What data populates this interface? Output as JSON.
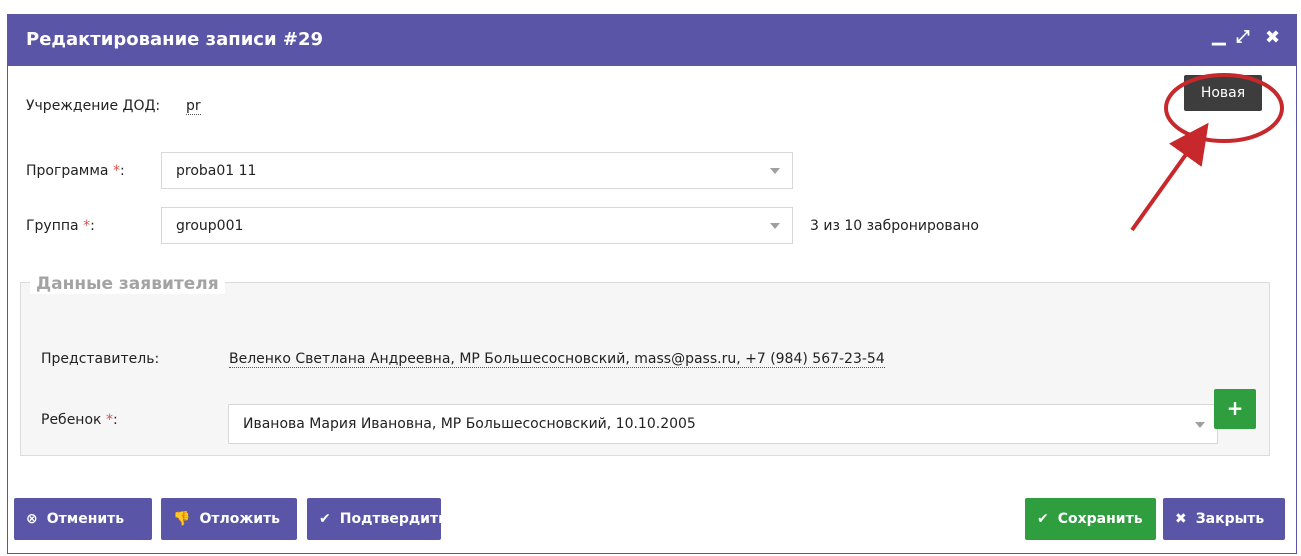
{
  "window": {
    "title": "Редактирование записи #29",
    "controls": {
      "minimize": "▁",
      "maximize": "⤢",
      "close": "✖"
    }
  },
  "form": {
    "institution": {
      "label": "Учреждение ДОД:",
      "value": "pr"
    },
    "status_badge": "Новая",
    "program": {
      "label": "Программа",
      "required_mark": "*",
      "colon": ":",
      "value": "proba01 11"
    },
    "group": {
      "label": "Группа",
      "required_mark": "*",
      "colon": ":",
      "value": "group001",
      "booking_note": "3 из 10 забронировано"
    }
  },
  "applicant": {
    "legend": "Данные заявителя",
    "representative": {
      "label": "Представитель:",
      "value": "Веленко Светлана Андреевна, МР Большесосновский, mass@pass.ru, +7 (984) 567-23-54"
    },
    "child": {
      "label": "Ребенок",
      "required_mark": "*",
      "colon": ":",
      "value": "Иванова Мария Ивановна, МР Большесосновский, 10.10.2005",
      "add_icon": "+"
    }
  },
  "footer": {
    "cancel": {
      "label": "Отменить",
      "icon": "times-circle-icon"
    },
    "postpone": {
      "label": "Отложить",
      "icon": "thumbs-down-icon"
    },
    "confirm": {
      "label": "Подтвердить",
      "icon": "check-icon"
    },
    "save": {
      "label": "Сохранить",
      "icon": "check-icon"
    },
    "close": {
      "label": "Закрыть",
      "icon": "close-icon"
    }
  },
  "colors": {
    "header": "#5a55a6",
    "primary_button": "#5a55a6",
    "success_button": "#2e9e3f",
    "badge": "#3d3d3d",
    "required": "#d9534f",
    "annotation": "#c6282b"
  }
}
